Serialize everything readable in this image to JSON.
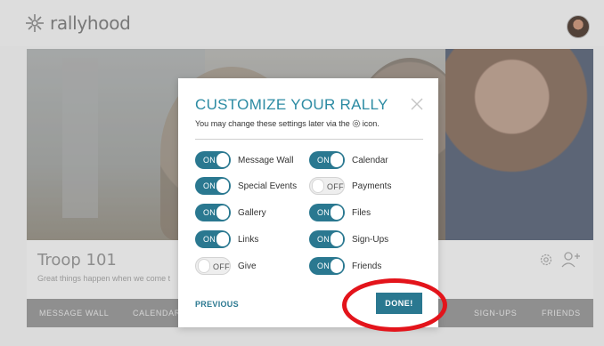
{
  "app": {
    "logo_text": "rallyhood"
  },
  "group": {
    "title": "Troop 101",
    "tagline": "Great things happen when we come t"
  },
  "nav": {
    "items": [
      "MESSAGE WALL",
      "CALENDAR",
      "SIGN-UPS",
      "FRIENDS"
    ]
  },
  "modal": {
    "title": "CUSTOMIZE YOUR RALLY",
    "subtitle_before": "You may change these settings later via the",
    "subtitle_after": "icon.",
    "toggles": [
      {
        "label": "Message Wall",
        "state": "ON"
      },
      {
        "label": "Special Events",
        "state": "ON"
      },
      {
        "label": "Gallery",
        "state": "ON"
      },
      {
        "label": "Links",
        "state": "ON"
      },
      {
        "label": "Give",
        "state": "OFF"
      },
      {
        "label": "Calendar",
        "state": "ON"
      },
      {
        "label": "Payments",
        "state": "OFF"
      },
      {
        "label": "Files",
        "state": "ON"
      },
      {
        "label": "Sign-Ups",
        "state": "ON"
      },
      {
        "label": "Friends",
        "state": "ON"
      }
    ],
    "previous_label": "PREVIOUS",
    "done_label": "DONE!"
  },
  "colors": {
    "accent": "#2a7890",
    "title": "#2c8ba3",
    "highlight": "#e3141b"
  }
}
